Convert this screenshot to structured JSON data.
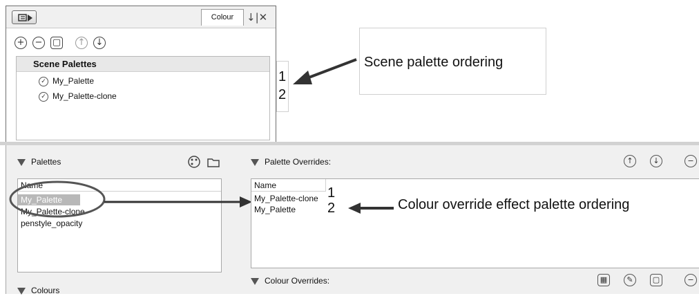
{
  "top_panel": {
    "colour_tab": "Colour",
    "tab_controls": "↓|✕",
    "toolbar": {
      "add": "+",
      "remove": "−",
      "clone": "▢",
      "up": "↑",
      "down": "↓"
    },
    "scene_palettes_header": "Scene Palettes",
    "scene_palettes": [
      {
        "name": "My_Palette"
      },
      {
        "name": "My_Palette-clone"
      }
    ]
  },
  "scene_order_numbers": [
    "1",
    "2"
  ],
  "scene_caption": "Scene palette ordering",
  "bottom_panel": {
    "palettes_title": "Palettes",
    "palettes_name_header": "Name",
    "palettes": [
      {
        "name": "My_Palette",
        "selected": true
      },
      {
        "name": "My_Palette-clone",
        "selected": false
      },
      {
        "name": "penstyle_opacity",
        "selected": false
      }
    ],
    "overrides_title": "Palette Overrides:",
    "overrides_name_header": "Name",
    "overrides": [
      {
        "name": "My_Palette-clone"
      },
      {
        "name": "My_Palette"
      }
    ],
    "override_order_numbers": [
      "1",
      "2"
    ],
    "override_caption": "Colour override effect palette ordering",
    "colour_overrides_title": "Colour Overrides:",
    "colours_title": "Colours"
  },
  "colors": {
    "panel_bg": "#f0f0f0",
    "selection": "#b8b8b8",
    "annotation": "#333333"
  }
}
